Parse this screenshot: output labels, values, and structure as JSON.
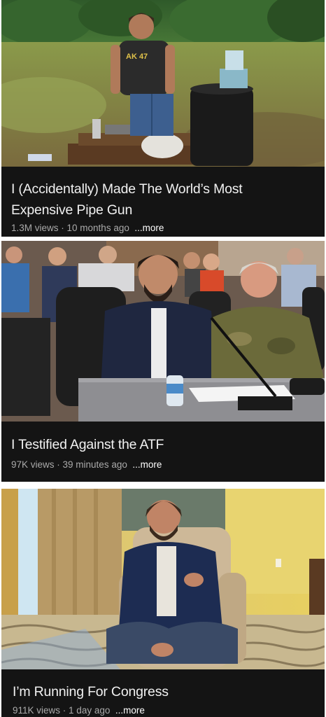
{
  "feed": {
    "videos": [
      {
        "title": "I (Accidentally) Made The World's Most Expensive Pipe Gun",
        "title_line1": "I (Accidentally) Made The World’s Most",
        "title_line2": "Expensive Pipe Gun",
        "views": "1.3M views",
        "separator": " · ",
        "age": "10 months ago",
        "more": "...more",
        "thumbnail_shirt_text": "AK 47"
      },
      {
        "title": "I Testified Against the ATF",
        "views": "97K views",
        "separator": " · ",
        "age": "39 minutes ago",
        "more": "...more"
      },
      {
        "title": "I’m Running For Congress",
        "views": "911K views",
        "separator": " · ",
        "age": "1 day ago",
        "more": "...more"
      }
    ]
  }
}
